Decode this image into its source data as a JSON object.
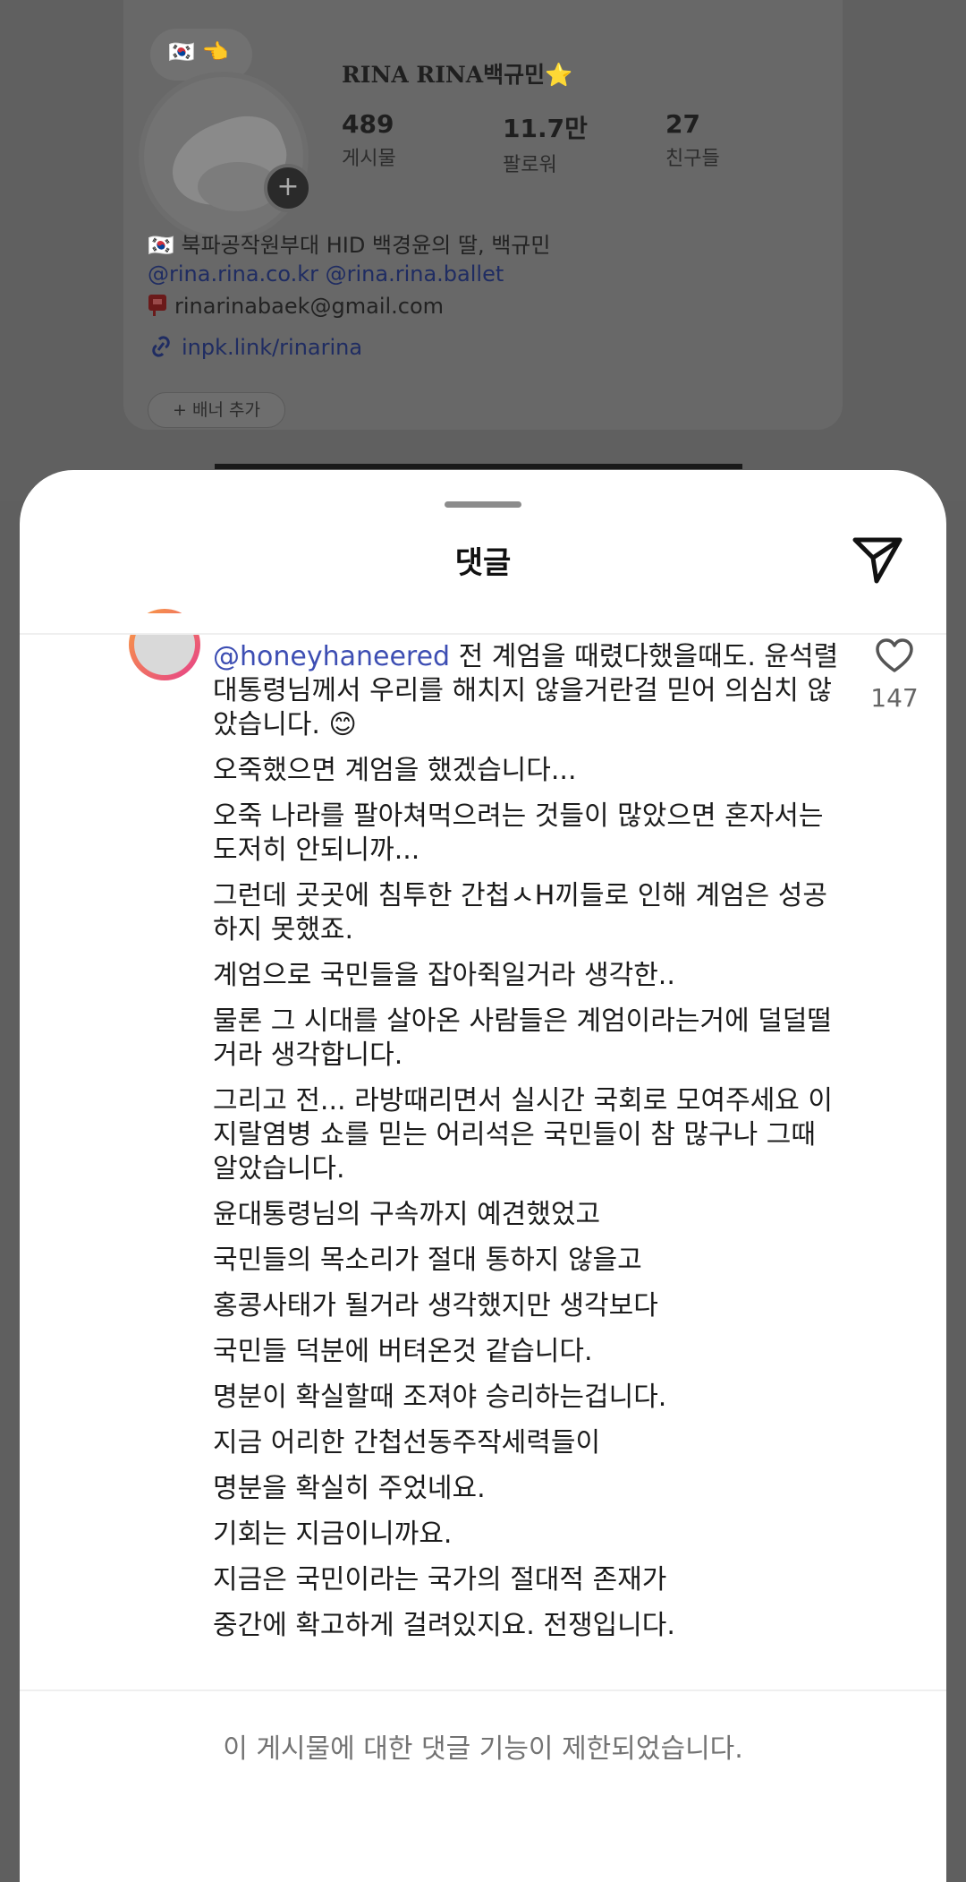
{
  "profile": {
    "display_name": "RINA RINA백규민⭐",
    "story_bubble_text": "🇰🇷 👈",
    "stats": [
      {
        "value": "489",
        "label": "게시물"
      },
      {
        "value": "11.7만",
        "label": "팔로워"
      },
      {
        "value": "27",
        "label": "친구들"
      }
    ],
    "bio_line": "🇰🇷 북파공작원부대 HID 백경윤의 딸, 백규민",
    "linked_accounts": "@rina.rina.co.kr @rina.rina.ballet",
    "email": "rinarinabaek@gmail.com",
    "link": "inpk.link/rinarina",
    "add_banner_label": "+ 배너 추가"
  },
  "sheet": {
    "title": "댓글"
  },
  "comment": {
    "mention": "@honeyhaneered",
    "paragraphs": [
      "전 계엄을 때렸다했을때도. 윤석렬대통령님께서 우리를 해치지 않을거란걸 믿어 의심치 않았습니다. 😊",
      "오죽했으면 계엄을 했겠습니다...",
      "오죽 나라를 팔아쳐먹으려는 것들이 많았으면 혼자서는 도저히 안되니까...",
      "그런데 곳곳에 침투한 간첩ㅅH끼들로 인해 계엄은 성공하지 못했죠.",
      "계엄으로 국민들을 잡아쥑일거라 생각한..",
      "물론 그 시대를 살아온 사람들은 계엄이라는거에 덜덜떨거라 생각합니다.",
      "그리고 전... 라방때리면서 실시간 국회로 모여주세요 이지랄염병 쇼를 믿는 어리석은 국민들이 참 많구나 그때 알았습니다.",
      "윤대통령님의 구속까지 예견했었고",
      "국민들의 목소리가 절대 통하지 않을고",
      "홍콩사태가 될거라 생각했지만 생각보다",
      "국민들 덕분에 버텨온것 같습니다.",
      "명분이 확실할때 조져야 승리하는겁니다.",
      "지금 어리한 간첩선동주작세력들이",
      "명분을 확실히 주었네요.",
      "기회는 지금이니까요.",
      "지금은 국민이라는 국가의 절대적 존재가",
      "중간에 확고하게 걸려있지요. 전쟁입니다."
    ],
    "like_count": "147"
  },
  "footer": {
    "notice": "이 게시물에 대한 댓글 기능이 제한되었습니다."
  },
  "colors": {
    "mention": "#3d4eb3",
    "overlay": "#606060"
  }
}
